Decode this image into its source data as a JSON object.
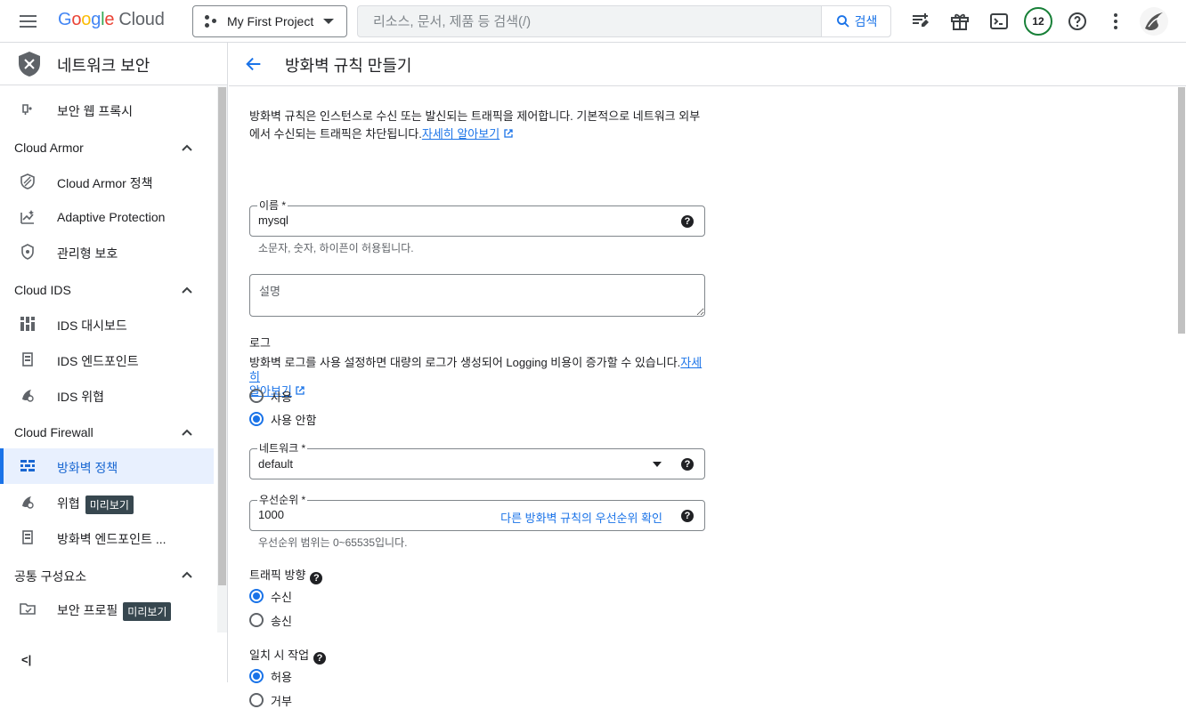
{
  "topbar": {
    "logo_google": [
      "G",
      "o",
      "o",
      "g",
      "l",
      "e"
    ],
    "logo_cloud": "Cloud",
    "project": "My First Project",
    "search_placeholder": "리소스, 문서, 제품 등 검색(/)",
    "search_button": "검색",
    "notifications_count": "12"
  },
  "sidebar": {
    "title": "네트워크 보안",
    "items": {
      "secure_web_proxy": "보안 웹 프록시",
      "group_cloud_armor": "Cloud Armor",
      "cloud_armor_policy": "Cloud Armor 정책",
      "adaptive_protection": "Adaptive Protection",
      "managed_protection": "관리형 보호",
      "group_cloud_ids": "Cloud IDS",
      "ids_dashboard": "IDS 대시보드",
      "ids_endpoint": "IDS 엔드포인트",
      "ids_threat": "IDS 위협",
      "group_cloud_firewall": "Cloud Firewall",
      "firewall_policy": "방화벽 정책",
      "threat": "위협",
      "firewall_endpoint": "방화벽 엔드포인트 ...",
      "group_common": "공통 구성요소",
      "security_profile": "보안 프로필"
    },
    "preview_label": "미리보기",
    "collapse": "<|"
  },
  "main": {
    "title": "방화벽 규칙 만들기",
    "intro": "방화벽 규칙은 인스턴스로 수신 또는 발신되는 트래픽을 제어합니다. 기본적으로 네트워크 외부에서 수신되는 트래픽은 차단됩니다.",
    "learn_more": "자세히 알아보기",
    "name_label": "이름 *",
    "name_value": "mysql",
    "name_hint": "소문자, 숫자, 하이픈이 허용됩니다.",
    "description_placeholder": "설명",
    "logs_heading": "로그",
    "logs_text": "방화벽 로그를 사용 설정하면 대량의 로그가 생성되어 Logging 비용이 증가할 수 있습니다.",
    "logs_learn_1": "자세히",
    "logs_learn_2": "알아보기",
    "logs_on": "사용",
    "logs_off": "사용 안함",
    "network_label": "네트워크 *",
    "network_value": "default",
    "priority_label": "우선순위 *",
    "priority_value": "1000",
    "priority_link": "다른 방화벽 규칙의 우선순위 확인",
    "priority_hint": "우선순위 범위는 0~65535입니다.",
    "direction_heading": "트래픽 방향",
    "direction_ingress": "수신",
    "direction_egress": "송신",
    "action_heading": "일치 시 작업",
    "action_allow": "허용",
    "action_deny": "거부"
  },
  "colors": {
    "accent": "#1a73e8",
    "badge_ring": "#188038",
    "pill_bg": "#37474f"
  }
}
